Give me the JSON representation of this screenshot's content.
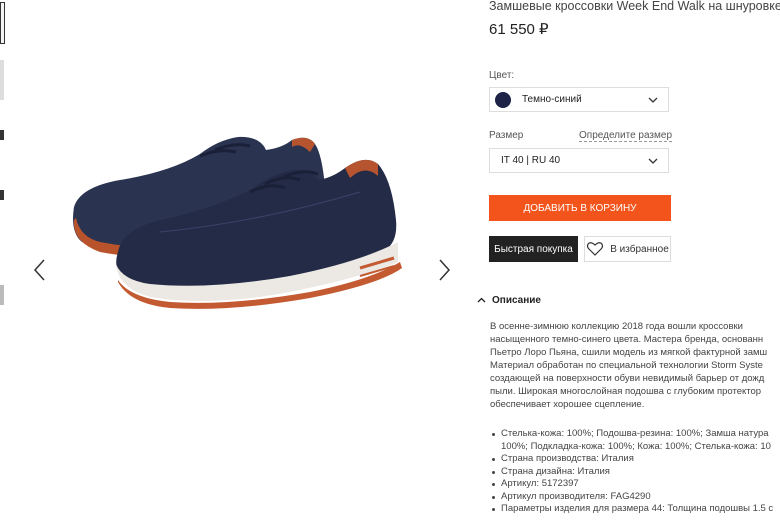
{
  "product": {
    "title": "Замшевые кроссовки Week End Walk на шнуровке",
    "price": "61 550 ₽"
  },
  "color": {
    "label": "Цвет:",
    "value": "Темно-синий",
    "swatch": "#1c2346"
  },
  "size": {
    "label": "Размер",
    "guide_link": "Определите размер",
    "value": "IT 40 | RU 40"
  },
  "buttons": {
    "add_to_cart": "ДОБАВИТЬ В КОРЗИНУ",
    "quick_buy": "Быстрая покупка",
    "favorites": "В избранное"
  },
  "description": {
    "heading": "Описание",
    "lines": [
      "В осенне-зимнюю коллекцию 2018 года вошли кроссовки",
      "насыщенного темно-синего цвета. Мастера бренда, основанн",
      "Пьетро Лоро Пьяна, сшили модель из мягкой фактурной замш",
      "Материал обработан по специальной технологии Storm Syste",
      "создающей на поверхности обуви невидимый барьер от дожд",
      "пыли. Широкая многослойная подошва с глубоким протектор",
      "обеспечивает хорошее сцепление."
    ],
    "specs": [
      "Стелька-кожа: 100%; Подошва-резина: 100%; Замша натура",
      "100%; Подкладка-кожа: 100%; Кожа: 100%; Стелька-кожа: 10",
      "Страна производства: Италия",
      "Страна дизайна: Италия",
      "Артикул: 5172397",
      "Артикул производителя: FAG4290",
      "Параметры изделия для размера 44: Толщина подошвы 1.5 с"
    ]
  },
  "colors": {
    "accent": "#f2541b",
    "dark_button": "#222222"
  }
}
